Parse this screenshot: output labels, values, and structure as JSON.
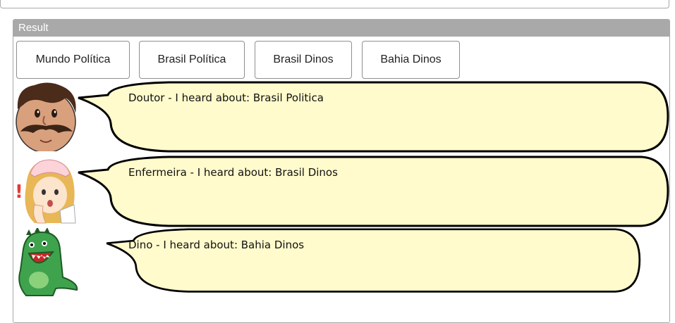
{
  "result": {
    "header": "Result",
    "buttons": [
      {
        "label": "Mundo Política"
      },
      {
        "label": "Brasil Política"
      },
      {
        "label": "Brasil Dinos"
      },
      {
        "label": "Bahia Dinos"
      }
    ],
    "messages": [
      {
        "text": "Doutor - I heard about: Brasil Politica",
        "avatar": "doctor-icon"
      },
      {
        "text": "Enfermeira - I heard about: Brasil Dinos",
        "avatar": "nurse-icon"
      },
      {
        "text": "Dino - I heard about: Bahia Dinos",
        "avatar": "dino-icon"
      }
    ]
  },
  "colors": {
    "header_bg": "#a9a9a9",
    "bubble_fill": "#fffbcc",
    "bubble_stroke": "#000000"
  }
}
